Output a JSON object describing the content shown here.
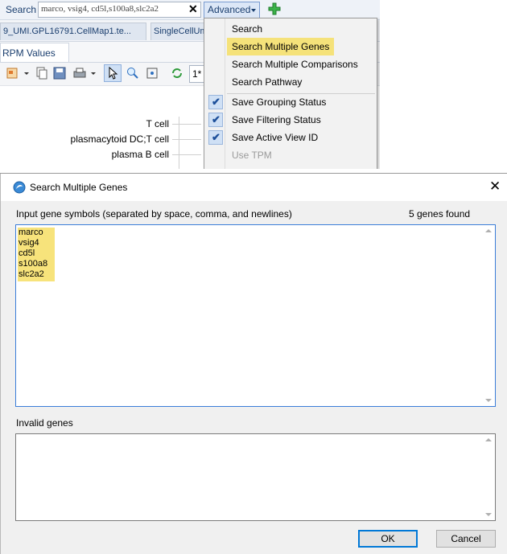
{
  "toolbar": {
    "search_label": "Search",
    "search_value": "marco, vsig4, cd5l,s100a8,slc2a2",
    "clear_glyph": "✕",
    "advanced_label": "Advanced",
    "add_icon": "green-plus-icon"
  },
  "doc_tabs": [
    {
      "label": "9_UMI.GPL16791.CellMap1.te..."
    },
    {
      "label": "SingleCellUm"
    }
  ],
  "view_tab": {
    "label": "RPM Values"
  },
  "zoom_value": "1*",
  "chart_rows": [
    {
      "label": "T cell"
    },
    {
      "label": "plasmacytoid DC;T cell"
    },
    {
      "label": "plasma B cell"
    }
  ],
  "advanced_menu": {
    "items": [
      {
        "label": "Search",
        "checked": false,
        "highlighted": false,
        "disabled": false
      },
      {
        "label": "Search Multiple Genes",
        "checked": false,
        "highlighted": true,
        "disabled": false
      },
      {
        "label": "Search Multiple Comparisons",
        "checked": false,
        "highlighted": false,
        "disabled": false
      },
      {
        "label": "Search Pathway",
        "checked": false,
        "highlighted": false,
        "disabled": false
      },
      {
        "label": "Save Grouping Status",
        "checked": true,
        "highlighted": false,
        "disabled": false
      },
      {
        "label": "Save Filtering Status",
        "checked": true,
        "highlighted": false,
        "disabled": false
      },
      {
        "label": "Save Active View ID",
        "checked": true,
        "highlighted": false,
        "disabled": false
      },
      {
        "label": "Use TPM",
        "checked": false,
        "highlighted": false,
        "disabled": true
      }
    ],
    "check_glyph": "✔"
  },
  "dialog": {
    "title": "Search Multiple Genes",
    "close_glyph": "✕",
    "input_label": "Input gene symbols (separated by space, comma, and newlines)",
    "genes_found": "5 genes found",
    "genes": [
      "marco",
      "vsig4",
      "cd5l",
      "s100a8",
      "slc2a2"
    ],
    "invalid_label": "Invalid genes",
    "invalid_genes": "",
    "ok_label": "OK",
    "cancel_label": "Cancel"
  },
  "colors": {
    "highlight": "#f5e27a",
    "accent_blue": "#0078d7",
    "toolbar_bg": "#eef2f8"
  }
}
